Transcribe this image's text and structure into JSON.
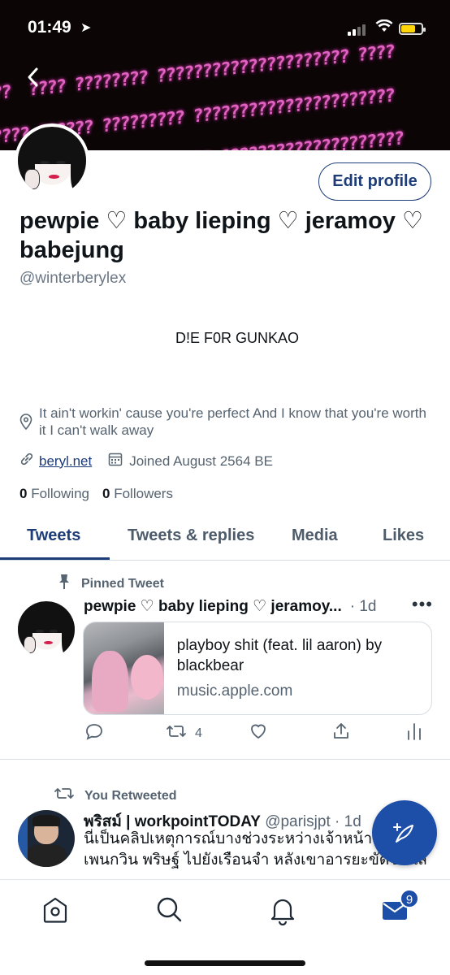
{
  "status_bar": {
    "time": "01:49"
  },
  "profile": {
    "name": "pewpie ♡ baby lieping ♡ jeramoy ♡ babejung",
    "handle": "@winterberylex",
    "bio": "D!E F0R GUNKAO",
    "location": "It ain't workin' cause you're perfect And I know that you're worth it I can't walk away",
    "website": "beryl.net",
    "joined": "Joined August 2564 BE",
    "following_count": "0",
    "following_label": "Following",
    "followers_count": "0",
    "followers_label": "Followers",
    "edit_button": "Edit profile"
  },
  "tabs": [
    {
      "label": "Tweets",
      "active": true
    },
    {
      "label": "Tweets & replies",
      "active": false
    },
    {
      "label": "Media",
      "active": false
    },
    {
      "label": "Likes",
      "active": false
    }
  ],
  "tweets": [
    {
      "context": "Pinned Tweet",
      "author": "pewpie ♡ baby lieping ♡ jeramoy...",
      "time": "· 1d",
      "card": {
        "title": "playboy shit (feat. lil aaron) by blackbear",
        "domain": "music.apple.com"
      },
      "retweet_count": "4"
    },
    {
      "context": "You Retweeted",
      "author": "พริสม์ | workpointTODAY",
      "handle": "@parisjpt",
      "time": "· 1d",
      "text": "นี่เป็นคลิปเหตุการณ์บางช่วงระหว่างเจ้าหน้าที่ เพนกวิน พริษฐ์ ไปยังเรือนจำ หลังเขาอารยะขัดขืนใส่"
    }
  ],
  "bottom_nav": {
    "messages_badge": "9"
  },
  "colors": {
    "accent": "#1d3c78",
    "fab": "#1d4fa8",
    "banner_pink": "#f06ad0"
  },
  "icons": [
    "back-arrow-icon",
    "location-pin-icon",
    "link-icon",
    "calendar-icon",
    "pin-icon",
    "retweet-icon",
    "reply-icon",
    "like-icon",
    "share-icon",
    "analytics-icon",
    "more-icon",
    "compose-icon",
    "home-icon",
    "search-icon",
    "bell-icon",
    "mail-icon"
  ]
}
